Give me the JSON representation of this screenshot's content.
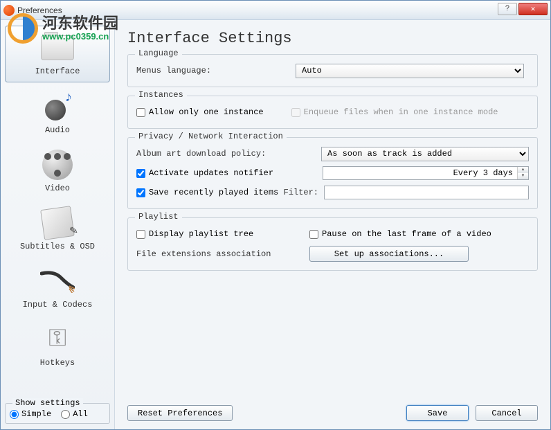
{
  "window": {
    "title": "Preferences"
  },
  "watermark": {
    "text": "河东软件园",
    "url": "www.pc0359.cn"
  },
  "sidebar": {
    "items": [
      {
        "label": "Interface"
      },
      {
        "label": "Audio"
      },
      {
        "label": "Video"
      },
      {
        "label": "Subtitles & OSD"
      },
      {
        "label": "Input & Codecs"
      },
      {
        "label": "Hotkeys"
      }
    ],
    "show_settings_label": "Show settings",
    "simple_label": "Simple",
    "all_label": "All"
  },
  "main": {
    "title": "Interface Settings",
    "groups": {
      "language": {
        "legend": "Language",
        "menus_lang_label": "Menus language:",
        "menus_lang_value": "Auto"
      },
      "instances": {
        "legend": "Instances",
        "allow_one": "Allow only one instance",
        "enqueue": "Enqueue files when in one instance mode"
      },
      "privacy": {
        "legend": "Privacy / Network Interaction",
        "album_art_label": "Album art download policy:",
        "album_art_value": "As soon as track is added",
        "activate_updates": "Activate updates notifier",
        "updates_interval": "Every 3 days",
        "save_recent": "Save recently played items",
        "filter_label": "Filter:",
        "filter_value": ""
      },
      "playlist": {
        "legend": "Playlist",
        "display_tree": "Display playlist tree",
        "pause_last_frame": "Pause on the last frame of a video",
        "file_ext_label": "File extensions association",
        "setup_btn": "Set up associations..."
      }
    }
  },
  "footer": {
    "reset": "Reset Preferences",
    "save": "Save",
    "cancel": "Cancel"
  }
}
